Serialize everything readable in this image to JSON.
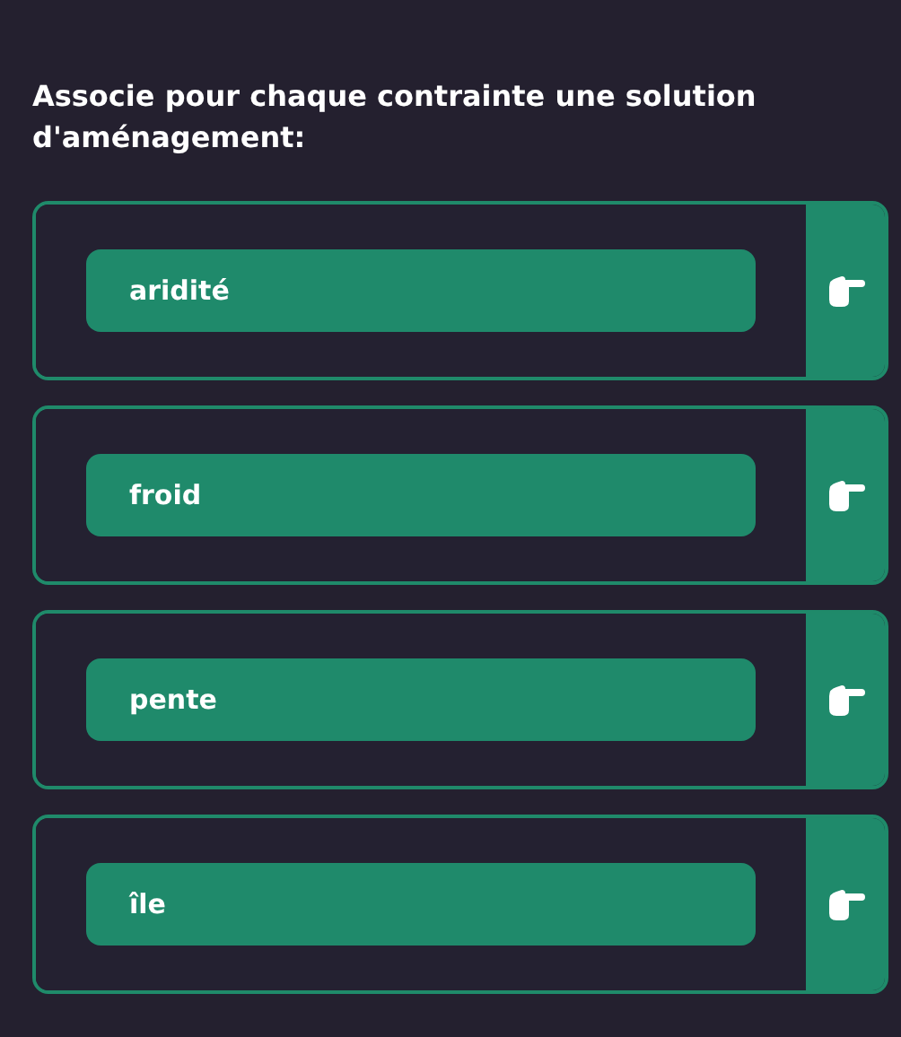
{
  "question": "Associe pour chaque contrainte une solution d'aménagement:",
  "items": [
    {
      "label": "aridité"
    },
    {
      "label": "froid"
    },
    {
      "label": "pente"
    },
    {
      "label": "île"
    }
  ]
}
